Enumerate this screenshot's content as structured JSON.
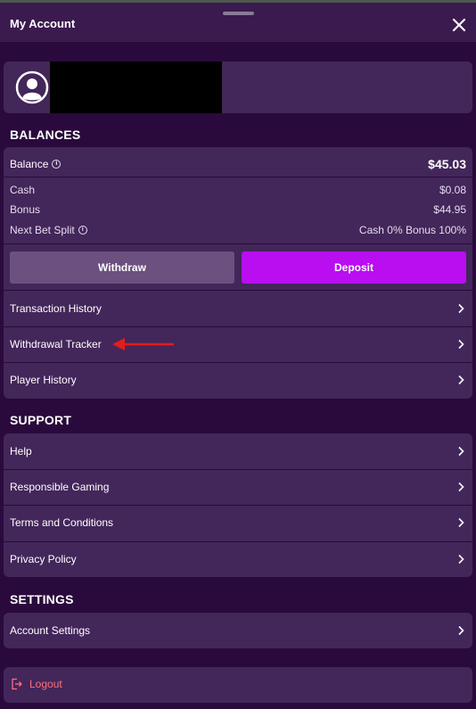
{
  "header": {
    "title": "My Account"
  },
  "balances": {
    "title": "BALANCES",
    "balance_label": "Balance",
    "balance_value": "$45.03",
    "cash_label": "Cash",
    "cash_value": "$0.08",
    "bonus_label": "Bonus",
    "bonus_value": "$44.95",
    "split_label": "Next Bet Split",
    "split_value": "Cash 0% Bonus 100%",
    "withdraw_label": "Withdraw",
    "deposit_label": "Deposit",
    "links": [
      {
        "label": "Transaction History"
      },
      {
        "label": "Withdrawal Tracker"
      },
      {
        "label": "Player History"
      }
    ]
  },
  "support": {
    "title": "SUPPORT",
    "links": [
      {
        "label": "Help"
      },
      {
        "label": "Responsible Gaming"
      },
      {
        "label": "Terms and Conditions"
      },
      {
        "label": "Privacy Policy"
      }
    ]
  },
  "settings": {
    "title": "SETTINGS",
    "links": [
      {
        "label": "Account Settings"
      }
    ]
  },
  "logout": {
    "label": "Logout"
  },
  "colors": {
    "background": "#2a0a3c",
    "card": "#43265a",
    "deposit": "#b80ef0",
    "withdraw": "#6c5080",
    "logout": "#ff6f7e",
    "annotation_arrow": "#e11d1d"
  },
  "icons": [
    "close-icon",
    "user-avatar-icon",
    "info-icon",
    "chevron-right-icon",
    "logout-icon",
    "annotation-arrow"
  ]
}
